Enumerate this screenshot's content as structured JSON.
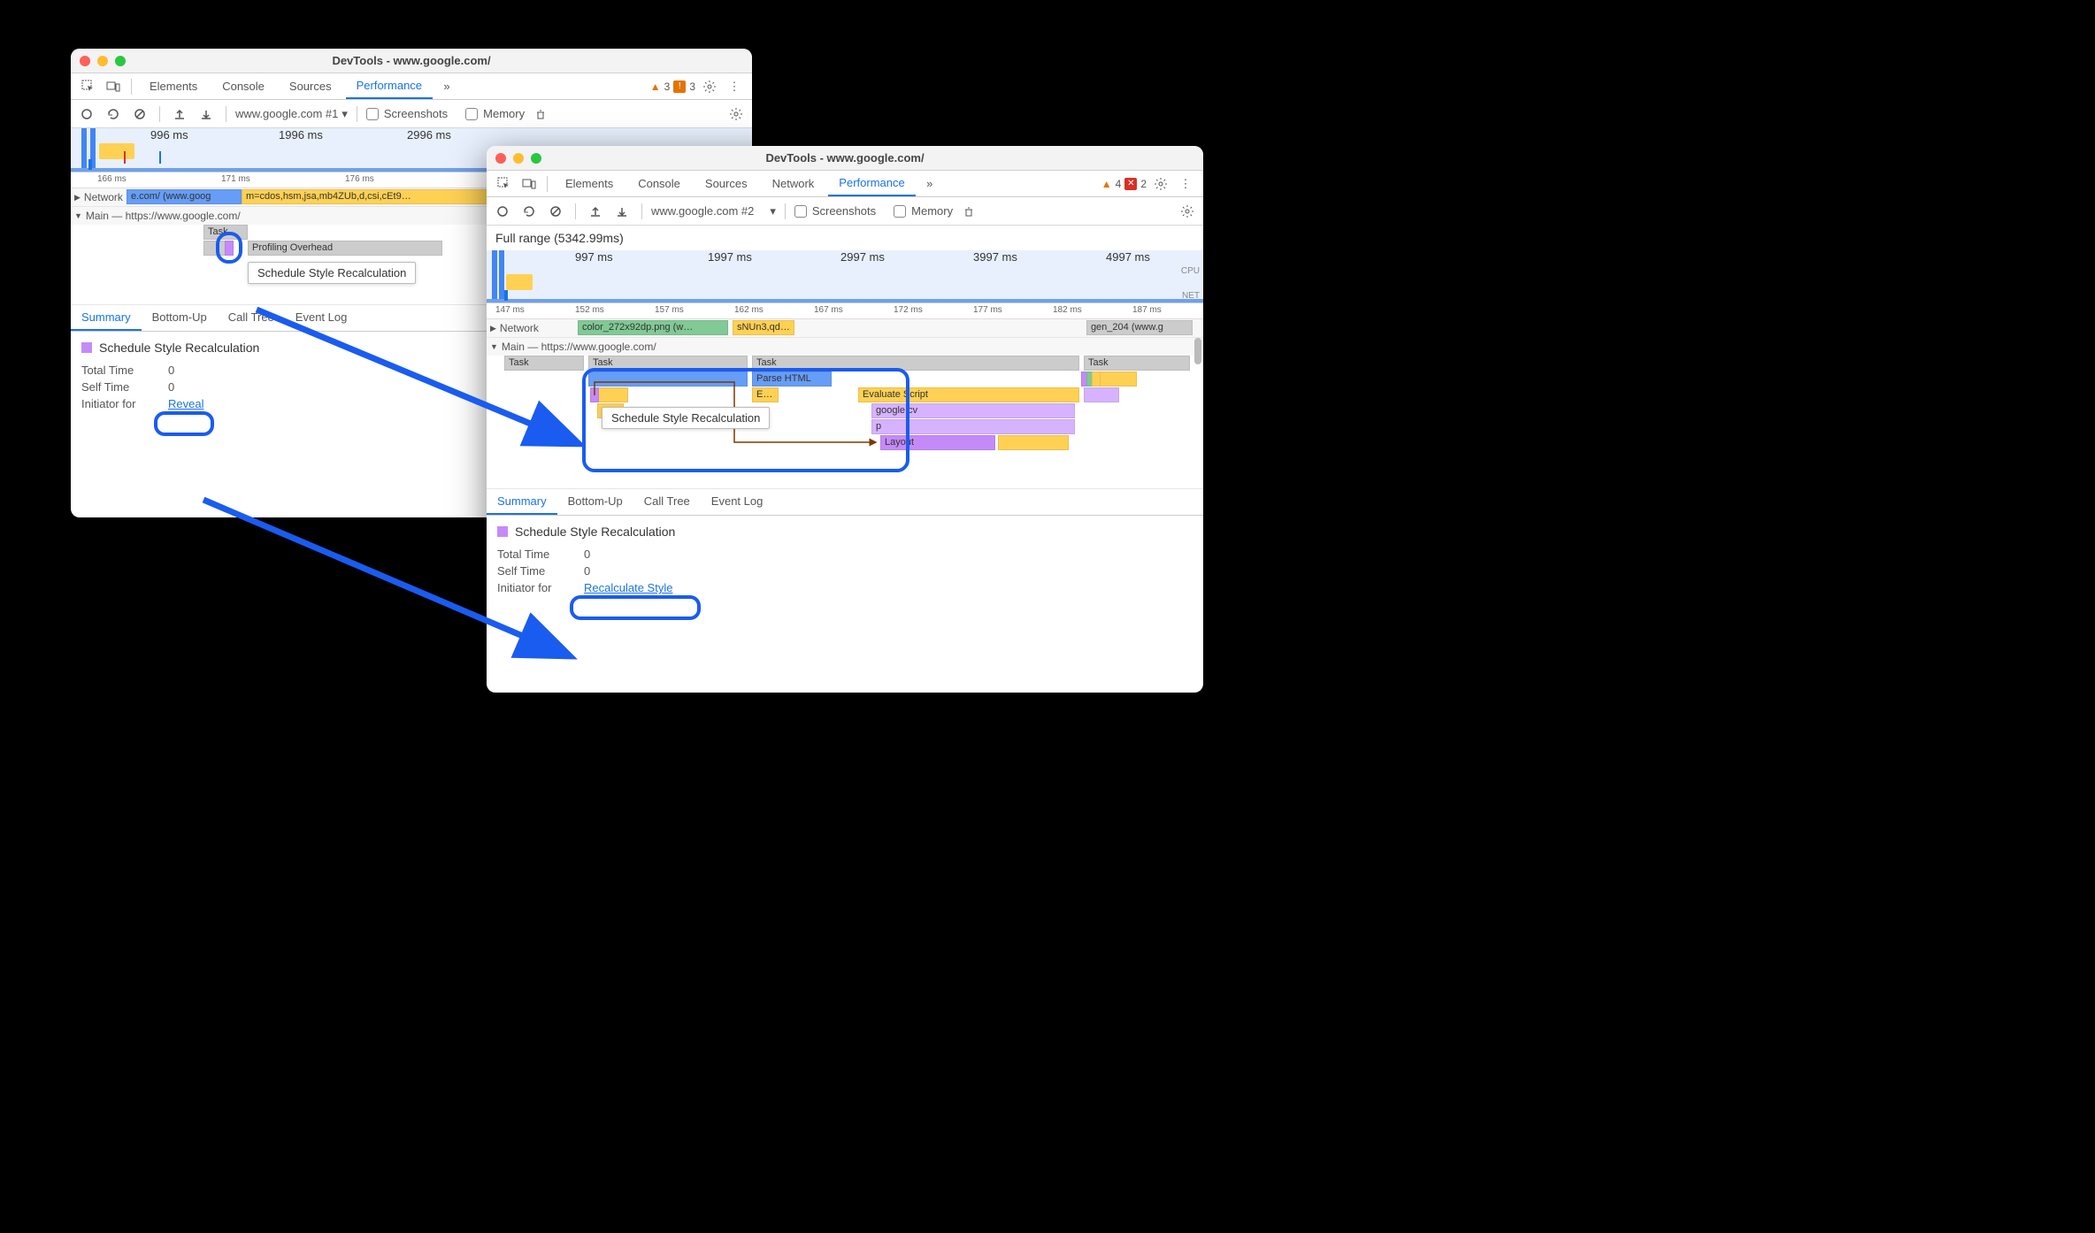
{
  "window1": {
    "title": "DevTools - www.google.com/",
    "tabs": {
      "elements": "Elements",
      "console": "Console",
      "sources": "Sources",
      "performance": "Performance"
    },
    "warnings": "3",
    "issues": "3",
    "toolbar": {
      "target": "www.google.com #1",
      "screenshots_label": "Screenshots",
      "memory_label": "Memory"
    },
    "overview_ticks": [
      "996 ms",
      "1996 ms",
      "2996 ms"
    ],
    "ruler_ticks": [
      "166 ms",
      "171 ms",
      "176 ms"
    ],
    "network_label": "Network",
    "network_item1": "e.com/ (www.goog",
    "network_item2": "m=cdos,hsm,jsa,mb4ZUb,d,csi,cEt9…",
    "main_label": "Main — https://www.google.com/",
    "flame_task": "Task",
    "flame_profiling": "Profiling Overhead",
    "flame_tooltip": "Schedule Style Recalculation",
    "details": {
      "summary": "Summary",
      "bottomup": "Bottom-Up",
      "calltree": "Call Tree",
      "eventlog": "Event Log",
      "event_name": "Schedule Style Recalculation",
      "total_time_k": "Total Time",
      "total_time_v": "0",
      "self_time_k": "Self Time",
      "self_time_v": "0",
      "initiator_k": "Initiator for",
      "reveal": "Reveal"
    }
  },
  "window2": {
    "title": "DevTools - www.google.com/",
    "tabs": {
      "elements": "Elements",
      "console": "Console",
      "sources": "Sources",
      "network": "Network",
      "performance": "Performance"
    },
    "warnings": "4",
    "errors": "2",
    "toolbar": {
      "target": "www.google.com #2",
      "screenshots_label": "Screenshots",
      "memory_label": "Memory"
    },
    "range_label": "Full range (5342.99ms)",
    "overview_ticks": [
      "997 ms",
      "1997 ms",
      "2997 ms",
      "3997 ms",
      "4997 ms"
    ],
    "ov_cpu_label": "CPU",
    "ov_net_label": "NET",
    "ruler_ticks": [
      "147 ms",
      "152 ms",
      "157 ms",
      "162 ms",
      "167 ms",
      "172 ms",
      "177 ms",
      "182 ms",
      "187 ms"
    ],
    "network_label": "Network",
    "network_items": [
      "color_272x92dp.png (w…",
      "sNUn3,qd…",
      "gen_204 (www.g"
    ],
    "main_label": "Main — https://www.google.com/",
    "tasks": "Task",
    "parse_html": "Parse HTML",
    "evaluate": "Evaluate Script",
    "google_cv": "google.cv",
    "p": "p",
    "e": "E…",
    "layout": "Layout",
    "flame_tooltip": "Schedule Style Recalculation",
    "details": {
      "summary": "Summary",
      "bottomup": "Bottom-Up",
      "calltree": "Call Tree",
      "eventlog": "Event Log",
      "event_name": "Schedule Style Recalculation",
      "total_time_k": "Total Time",
      "total_time_v": "0",
      "self_time_k": "Self Time",
      "self_time_v": "0",
      "initiator_k": "Initiator for",
      "recalc": "Recalculate Style"
    }
  }
}
